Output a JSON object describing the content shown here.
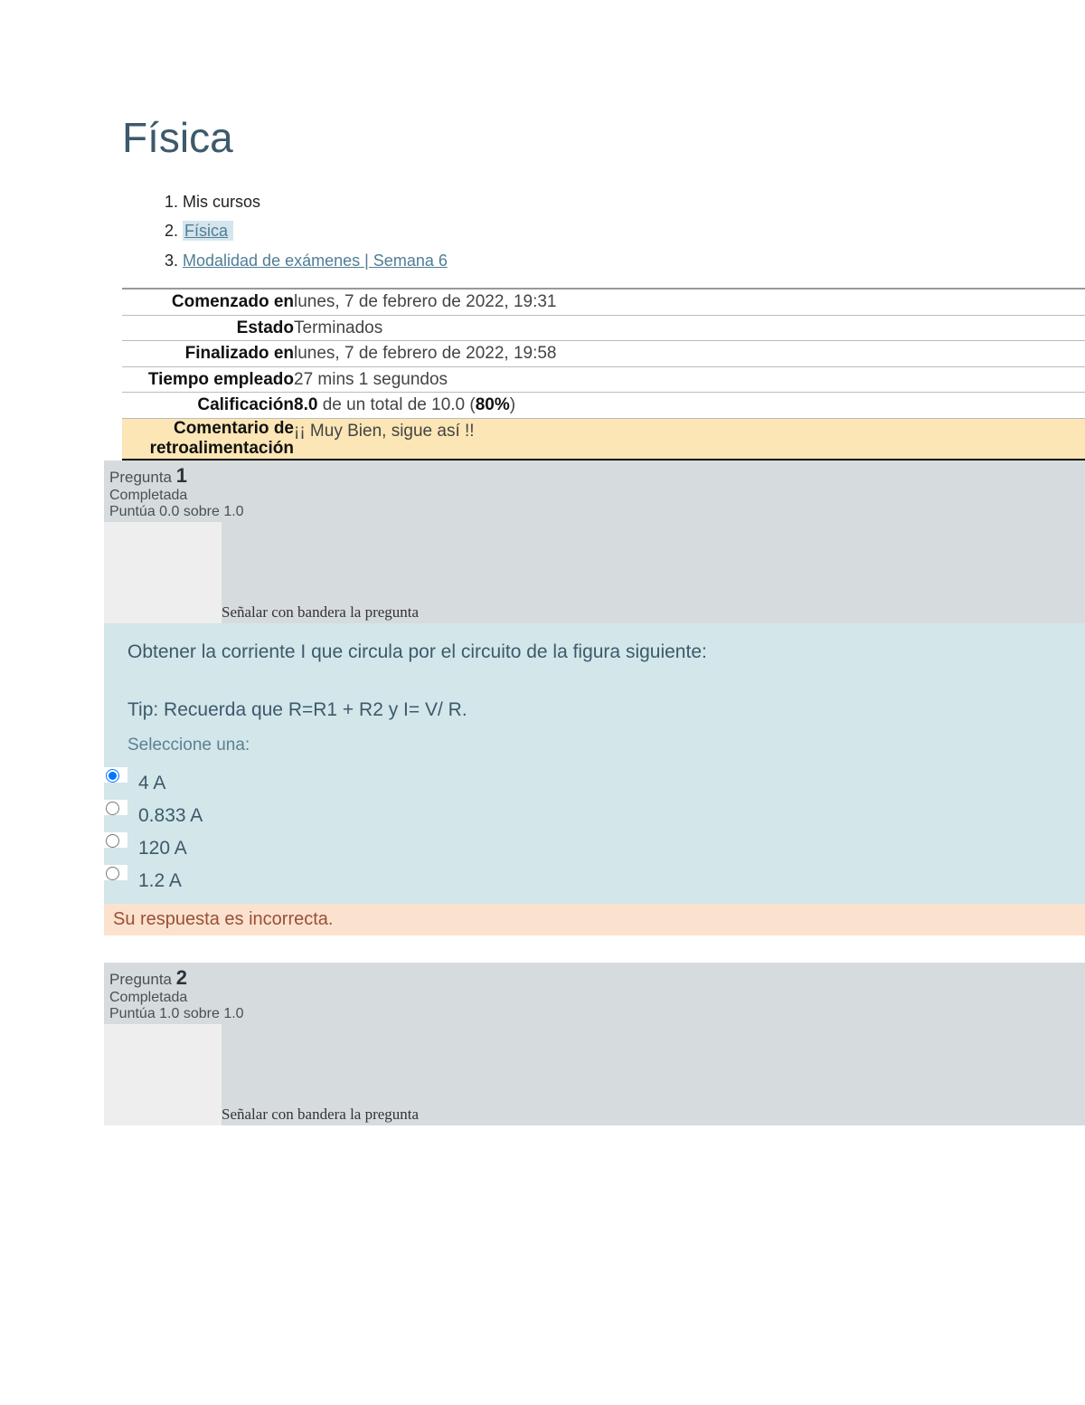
{
  "course_title": "Física",
  "breadcrumb": {
    "item1": "Mis cursos",
    "item2": "Física",
    "item3": "Modalidad de exámenes | Semana 6"
  },
  "summary": {
    "started_label": "Comenzado en",
    "started_value": "lunes, 7 de febrero de 2022, 19:31",
    "state_label": "Estado",
    "state_value": "Terminados",
    "finished_label": "Finalizado en",
    "finished_value": "lunes, 7 de febrero de 2022, 19:58",
    "time_label": "Tiempo empleado",
    "time_value": "27 mins 1 segundos",
    "grade_label": "Calificación",
    "grade_value_pre": "8.0",
    "grade_value_mid": " de un total de 10.0 (",
    "grade_value_pct": "80%",
    "grade_value_post": ")",
    "feedback_label_l1": "Comentario de",
    "feedback_label_l2": "retroalimentación",
    "feedback_value": "¡¡ Muy Bien, sigue así !!"
  },
  "q1": {
    "label": "Pregunta ",
    "number": "1",
    "state": "Completada",
    "score": "Puntúa 0.0 sobre 1.0",
    "flag": "Señalar con bandera la pregunta",
    "text": "Obtener la corriente I  que circula por el circuito de la figura siguiente:",
    "tip": "Tip: Recuerda que R=R1 + R2  y I= V/ R.",
    "select_one": "Seleccione una:",
    "options": {
      "a": "4 A",
      "b": "0.833 A",
      "c": "120 A",
      "d": "1.2 A"
    },
    "feedback": "Su respuesta es incorrecta."
  },
  "q2": {
    "label": "Pregunta ",
    "number": "2",
    "state": "Completada",
    "score": "Puntúa 1.0 sobre 1.0",
    "flag": "Señalar con bandera la pregunta"
  }
}
